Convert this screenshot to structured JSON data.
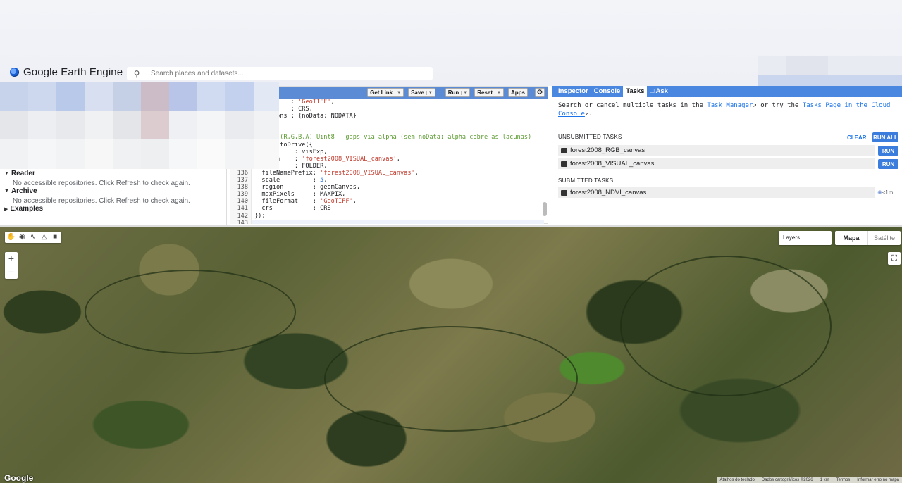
{
  "app": {
    "title": "Google Earth Engine"
  },
  "search": {
    "placeholder": "Search places and datasets..."
  },
  "left_panel": {
    "sections": [
      {
        "title": "Reader",
        "message": "No accessible repositories. Click Refresh to check again."
      },
      {
        "title": "Archive",
        "message": "No accessible repositories. Click Refresh to check again."
      },
      {
        "title": "Examples"
      }
    ]
  },
  "editor": {
    "toolbar": {
      "get_link": "Get Link",
      "save": "Save",
      "run": "Run",
      "reset": "Reset",
      "apps": "Apps"
    },
    "lines": [
      {
        "n": "",
        "t": "Format    : 'GeoTIFF',"
      },
      {
        "n": "",
        "t": "          : CRS,"
      },
      {
        "n": "",
        "t": "atOptions : {noData: NODATA}"
      },
      {
        "n": "",
        "t": ""
      },
      {
        "n": "",
        "t": ""
      },
      {
        "n": "",
        "t": "VISUAL (R,G,B,A) Uint8 — gaps via alpha (sem noData; alpha cobre as lacunas)"
      },
      {
        "n": "",
        "t": ".image.toDrive({"
      },
      {
        "n": "",
        "t": "e          : visExp,"
      },
      {
        "n": "",
        "t": "ription    : 'forest2008_VISUAL_canvas',"
      },
      {
        "n": "",
        "t": "er         : FOLDER,"
      },
      {
        "n": "136",
        "t": "  fileNamePrefix: 'forest2008_VISUAL_canvas',"
      },
      {
        "n": "137",
        "t": "  scale         : 5,"
      },
      {
        "n": "138",
        "t": "  region        : geomCanvas,"
      },
      {
        "n": "139",
        "t": "  maxPixels     : MAXPIX,"
      },
      {
        "n": "140",
        "t": "  fileFormat    : 'GeoTIFF',"
      },
      {
        "n": "141",
        "t": "  crs           : CRS"
      },
      {
        "n": "142",
        "t": "});"
      },
      {
        "n": "143",
        "t": ""
      }
    ]
  },
  "right_panel": {
    "tabs": [
      "Inspector",
      "Console",
      "Tasks",
      "Ask"
    ],
    "active_tab": "Tasks",
    "help": {
      "pre": "Search or cancel multiple tasks in the ",
      "link1": "Task Manager",
      "mid": " or try the ",
      "link2": "Tasks Page in the Cloud Console",
      "post": "."
    },
    "unsubmitted_title": "UNSUBMITTED TASKS",
    "clear_label": "CLEAR",
    "run_all_label": "RUN ALL",
    "unsubmitted": [
      {
        "name": "forest2008_RGB_canvas",
        "button": "RUN"
      },
      {
        "name": "forest2008_VISUAL_canvas",
        "button": "RUN"
      }
    ],
    "submitted_title": "SUBMITTED TASKS",
    "submitted": [
      {
        "name": "forest2008_NDVI_canvas",
        "status": "<1m"
      }
    ]
  },
  "map": {
    "layers_label": "Layers",
    "map_type": [
      "Mapa",
      "Satélite"
    ],
    "zoom_in": "+",
    "zoom_out": "−",
    "brand": "Google",
    "attribution": [
      "Atalhos do teclado",
      "Dados cartográficos ©2026",
      "1 km",
      "Termos",
      "Informar erro no mapa"
    ]
  },
  "icons": {
    "search": "search-icon",
    "gear": "gear-icon",
    "hand": "hand-icon",
    "marker": "marker-icon",
    "line": "line-icon",
    "polygon": "polygon-icon",
    "rectangle": "rectangle-icon",
    "fullscreen": "fullscreen-icon",
    "image": "image-icon",
    "spinner": "spinner-icon"
  }
}
